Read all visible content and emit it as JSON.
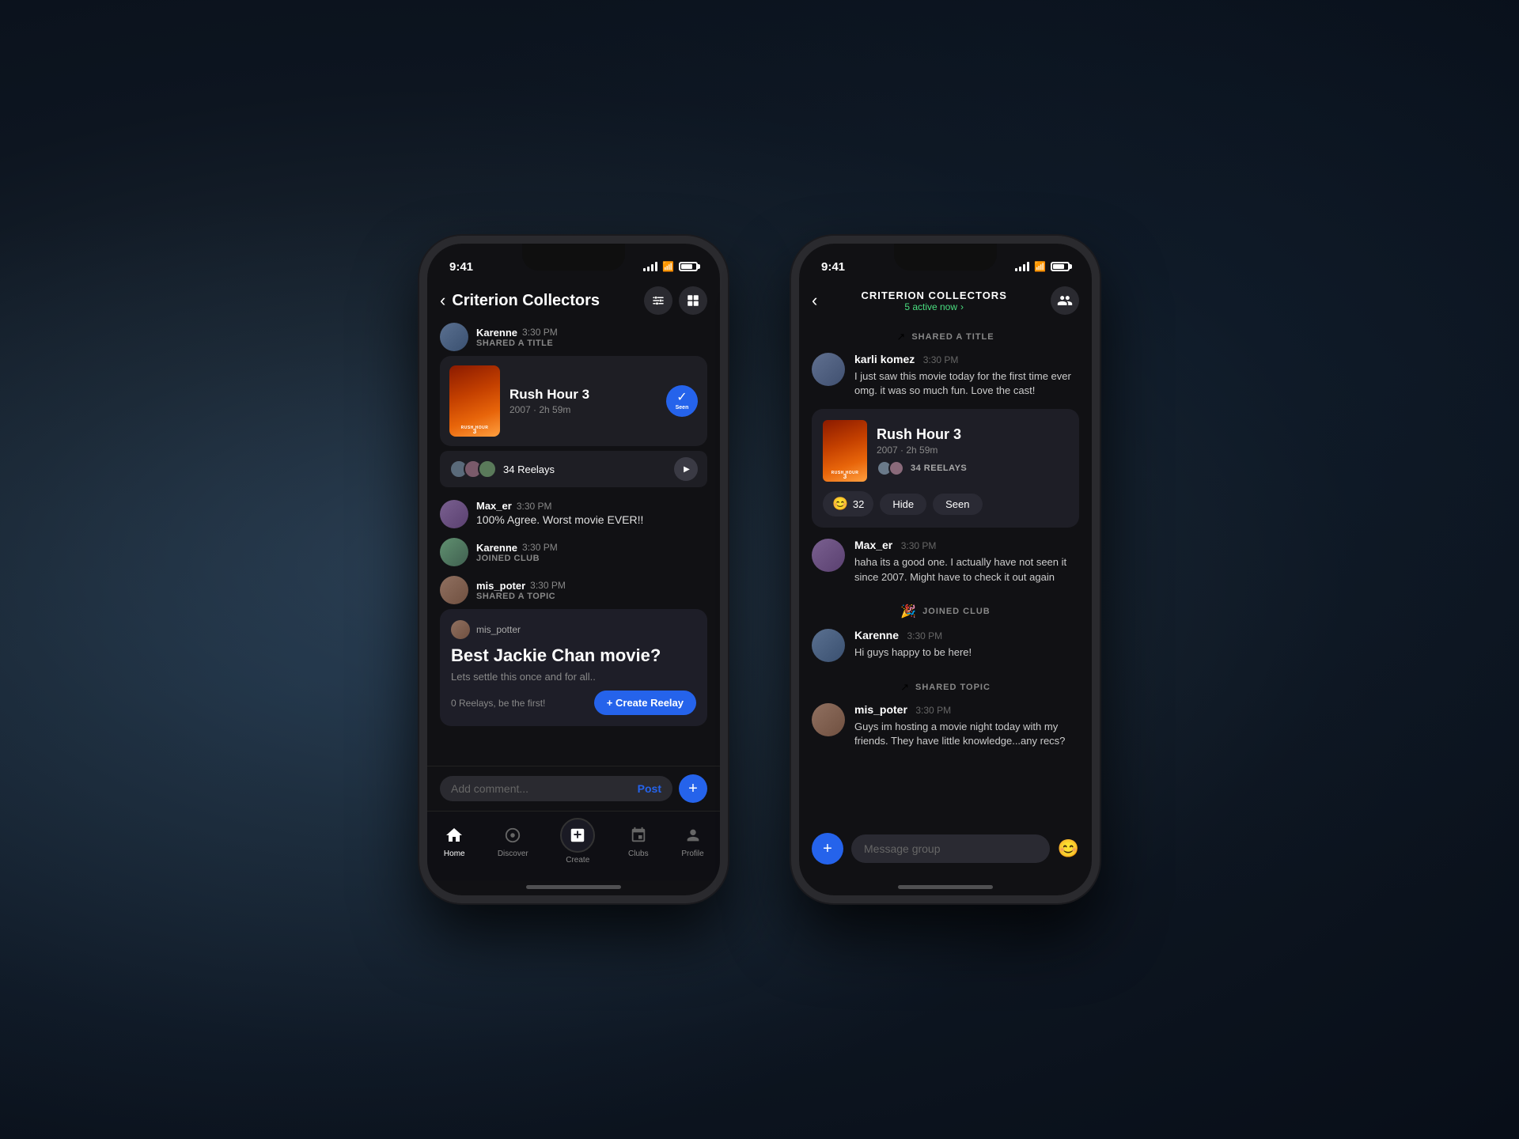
{
  "app": {
    "name": "Criterion Collectors"
  },
  "phone1": {
    "status": {
      "time": "9:41"
    },
    "header": {
      "back": "‹",
      "title": "Criterion Collectors",
      "filter_icon": "sliders",
      "grid_icon": "grid"
    },
    "feed": [
      {
        "type": "shared_title",
        "user": "Karenne",
        "time": "3:30 PM",
        "action": "SHARED A TITLE",
        "movie": {
          "title": "Rush Hour 3",
          "year": "2007",
          "duration": "2h 59m",
          "reelays": 34,
          "seen": true,
          "seen_label": "Seen"
        }
      },
      {
        "type": "comment",
        "user": "Max_er",
        "time": "3:30 PM",
        "text": "100% Agree. Worst movie EVER!!"
      },
      {
        "type": "joined",
        "user": "Karenne",
        "time": "3:30 PM",
        "action": "JOINED CLUB"
      },
      {
        "type": "shared_topic",
        "user": "mis_poter",
        "time": "3:30 PM",
        "action": "SHARED A TOPIC",
        "topic": {
          "title": "Best Jackie Chan movie?",
          "subtitle": "Lets settle this once and for all..",
          "reelays_text": "0 Reelays, be the first!",
          "create_btn": "+ Create Reelay"
        }
      }
    ],
    "comment_bar": {
      "placeholder": "Add comment...",
      "post_btn": "Post"
    },
    "bottom_nav": [
      {
        "id": "home",
        "label": "Home",
        "active": true
      },
      {
        "id": "discover",
        "label": "Discover",
        "active": false
      },
      {
        "id": "create",
        "label": "Create",
        "active": false
      },
      {
        "id": "clubs",
        "label": "Clubs",
        "active": false
      },
      {
        "id": "profile",
        "label": "Profile",
        "active": false
      }
    ]
  },
  "phone2": {
    "status": {
      "time": "9:41"
    },
    "header": {
      "title": "CRITERION COLLECTORS",
      "active_now": "5 active now"
    },
    "feed": [
      {
        "type": "shared_title_section",
        "label": "SHARED A TITLE",
        "comment": {
          "user": "karli komez",
          "time": "3:30 PM",
          "text": "I just saw this movie today for the first time ever omg. it was so much fun. Love the cast!"
        },
        "movie": {
          "title": "Rush Hour 3",
          "year": "2007",
          "duration": "2h 59m",
          "reelays": 34,
          "reactions": 32,
          "reaction_emoji": "😊",
          "hide_btn": "Hide",
          "seen_btn": "Seen"
        }
      },
      {
        "type": "comment",
        "user": "Max_er",
        "time": "3:30 PM",
        "text": "haha its a good one. I actually have not seen it since 2007. Might have to check it out again"
      },
      {
        "type": "joined",
        "label": "🎉 JOINED CLUB",
        "user": "Karenne",
        "time": "3:30 PM",
        "text": "Hi guys happy to be here!"
      },
      {
        "type": "shared_topic",
        "label": "SHARED TOPIC",
        "user": "mis_poter",
        "time": "3:30 PM",
        "text": "Guys im hosting a movie night today with my friends. They have little knowledge...any recs?"
      }
    ],
    "message_bar": {
      "placeholder": "Message group",
      "emoji": "😊"
    }
  }
}
